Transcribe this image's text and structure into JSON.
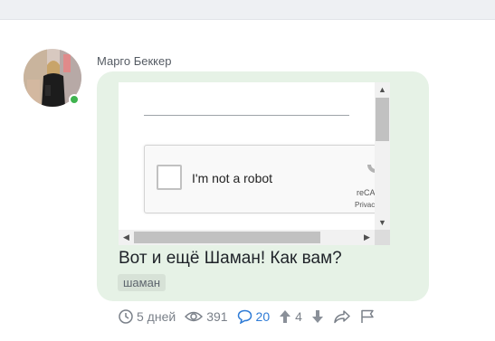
{
  "post": {
    "author": "Марго Беккер",
    "text": "Вот и ещё Шаман! Как вам?",
    "tag": "шаман"
  },
  "embed": {
    "captcha_label": "I'm not a robot",
    "brand": "reCAPTCHA",
    "links": "Privacy - Terms",
    "scroll_up": "▲",
    "scroll_down": "▼",
    "scroll_left": "◀",
    "scroll_right": "▶"
  },
  "actions": {
    "time": "5 дней",
    "views": "391",
    "comments": "20",
    "votes": "4"
  },
  "colors": {
    "bubble": "#e6f2e6",
    "online": "#3fb34f",
    "comment_accent": "#2e7bd6",
    "recaptcha_blue": "#4a90e2"
  },
  "icons": [
    "clock-icon",
    "eye-icon",
    "comment-icon",
    "arrow-up-icon",
    "arrow-down-icon",
    "share-icon",
    "flag-icon"
  ]
}
